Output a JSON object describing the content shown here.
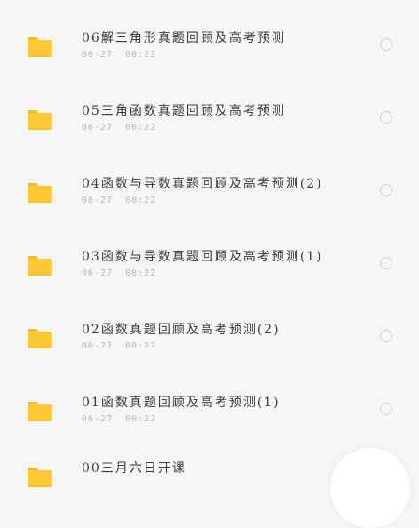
{
  "files": [
    {
      "name": "06解三角形真题回顾及高考预测",
      "date": "06-27",
      "time": "00:22"
    },
    {
      "name": "05三角函数真题回顾及高考预测",
      "date": "06-27",
      "time": "00:22"
    },
    {
      "name": "04函数与导数真题回顾及高考预测(2)",
      "date": "06-27",
      "time": "00:22"
    },
    {
      "name": "03函数与导数真题回顾及高考预测(1)",
      "date": "06-27",
      "time": "00:22"
    },
    {
      "name": "02函数真题回顾及高考预测(2)",
      "date": "06-27",
      "time": "00:22"
    },
    {
      "name": "01函数真题回顾及高考预测(1)",
      "date": "06-27",
      "time": "00:22"
    },
    {
      "name": "00三月六日开课"
    }
  ],
  "colors": {
    "folder": "#fcc835",
    "folder_tab": "#f4b92a",
    "background": "#f6f6f6",
    "title_text": "#3a3a3a",
    "meta_text": "#b6b6b6"
  },
  "icons": {
    "folder": "folder-icon",
    "select": "radio-circle-icon"
  }
}
